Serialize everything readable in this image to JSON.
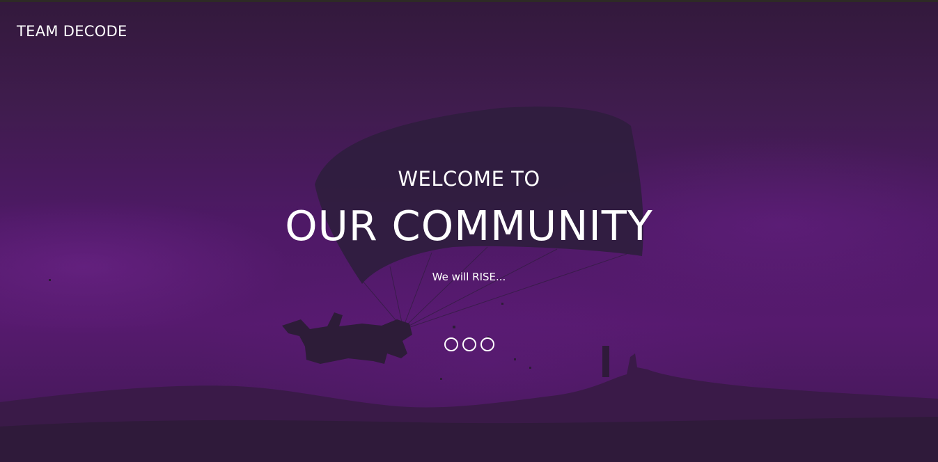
{
  "brand": {
    "name": "TEAM DECODE"
  },
  "hero": {
    "welcome": "WELCOME TO",
    "headline": "OUR COMMUNITY",
    "tagline": "We will RISE..."
  },
  "carousel": {
    "slides": 3
  },
  "colors": {
    "overlay_dark": "#33193c",
    "overlay_mid": "#561a6e",
    "text": "#ffffff"
  }
}
